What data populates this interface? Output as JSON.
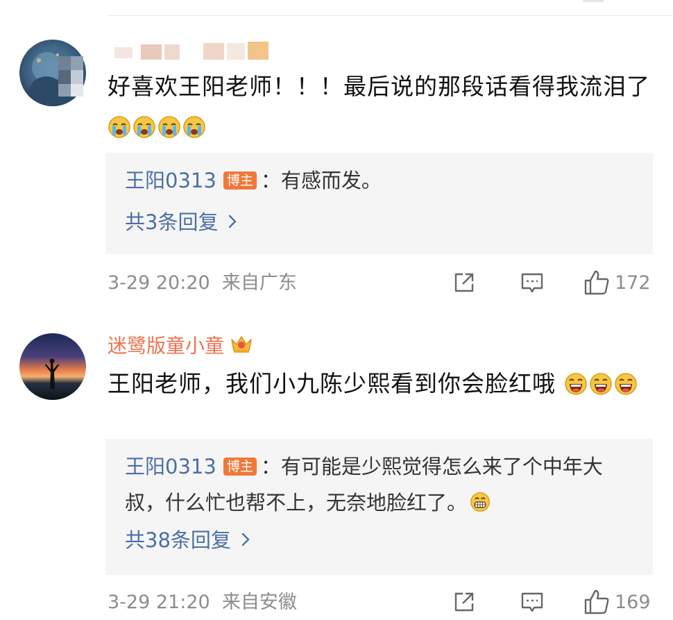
{
  "comments": [
    {
      "username": "",
      "body": "好喜欢王阳老师！！！最后说的那段话看得我流泪了",
      "body_emojis": [
        "crying-emoji",
        "crying-emoji",
        "crying-emoji",
        "crying-emoji"
      ],
      "reply": {
        "author": "王阳0313",
        "badge": "博主",
        "text": "：有感而发。"
      },
      "reply_count": "共3条回复",
      "time": "3-29 20:20",
      "location": "来自广东",
      "likes": "172",
      "icons": [
        "share-icon",
        "comment-icon",
        "like-icon",
        "crown-icon"
      ]
    },
    {
      "username": "迷鹭版童小童",
      "body": "王阳老师，我们小九陈少熙看到你会脸红哦",
      "body_emojis": [
        "laughing-emoji",
        "laughing-emoji",
        "laughing-emoji"
      ],
      "reply": {
        "author": "王阳0313",
        "badge": "博主",
        "text": "：有可能是少熙觉得怎么来了个中年大叔，什么忙也帮不上，无奈地脸红了。",
        "emoji": "grin-emoji"
      },
      "reply_count": "共38条回复",
      "time": "3-29 21:20",
      "location": "来自安徽",
      "likes": "169",
      "icons": [
        "share-icon",
        "comment-icon",
        "like-icon",
        "crown-icon"
      ]
    }
  ],
  "colors": {
    "accent_name": "#eb7350",
    "reply_author": "#4a6fa5",
    "badge": "#f07838",
    "reply_bg": "#f5f5f5",
    "meta": "#8c8c8c"
  }
}
